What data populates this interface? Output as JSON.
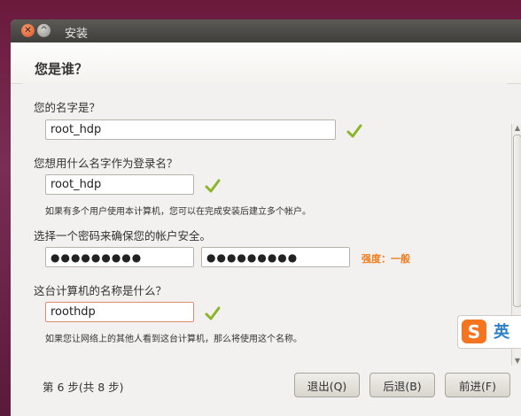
{
  "window": {
    "title": "安装"
  },
  "header": {
    "heading": "您是谁？"
  },
  "form": {
    "name_label": "您的名字是？",
    "name_value": "root_hdp",
    "login_label": "您想用什么名字作为登录名？",
    "login_value": "root_hdp",
    "login_hint": "如果有多个用户使用本计算机，您可以在完成安装后建立多个帐户。",
    "password_label": "选择一个密码来确保您的帐户安全。",
    "password_value": "●●●●●●●●●",
    "password_confirm_value": "●●●●●●●●●",
    "strength_text": "强度：一般",
    "computer_label": "这台计算机的名称是什么？",
    "computer_value": "roothdp",
    "computer_hint": "如果您让网络上的其他人看到这台计算机，那么将使用这个名称。"
  },
  "footer": {
    "step_text": "第 6 步(共 8 步)",
    "quit_label": "退出(Q)",
    "back_label": "后退(B)",
    "forward_label": "前进(F)"
  },
  "ime": {
    "mode": "英"
  },
  "colors": {
    "accent_check": "#8cb52c",
    "strength": "#f07c1c",
    "active_border": "#e08a70"
  }
}
